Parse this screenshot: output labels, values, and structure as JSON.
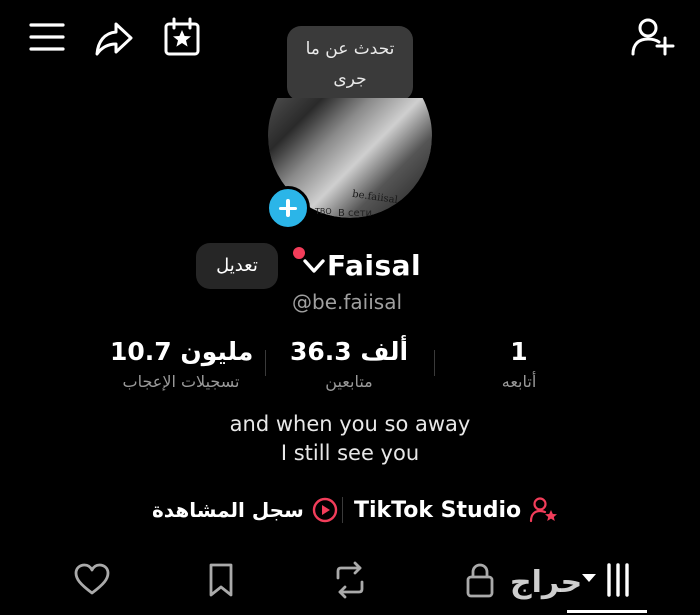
{
  "tooltip": {
    "line1": "تحدث عن ما",
    "line2": "جرى"
  },
  "profile": {
    "display_name": "Faisal",
    "username": "@be.faiisal",
    "edit_label": "تعديل",
    "avatar_text": "be.faiisal",
    "avatar_text2": "В сети",
    "avatar_text3": "ТВО"
  },
  "stats": {
    "likes": {
      "value": "10.7 مليون",
      "label": "تسجيلات الإعجاب"
    },
    "followers": {
      "value": "36.3 ألف",
      "label": "متابعين"
    },
    "following": {
      "value": "1",
      "label": "أتابعه"
    }
  },
  "bio": {
    "line1": "and when you so away",
    "line2": "I still see you"
  },
  "links": {
    "studio_label": "TikTok Studio",
    "history_label": "سجل المشاهدة"
  },
  "watermark": "حراج",
  "icons": {
    "menu": "menu-icon",
    "share": "share-icon",
    "calendar": "calendar-star-icon",
    "add_friend": "add-person-icon",
    "heart": "heart-icon",
    "bookmark": "bookmark-icon",
    "repost": "repost-icon",
    "lock": "lock-icon",
    "grid": "grid-icon"
  },
  "colors": {
    "accent_blue": "#2bb5e8",
    "accent_red": "#f23d5a",
    "background": "#000000"
  }
}
